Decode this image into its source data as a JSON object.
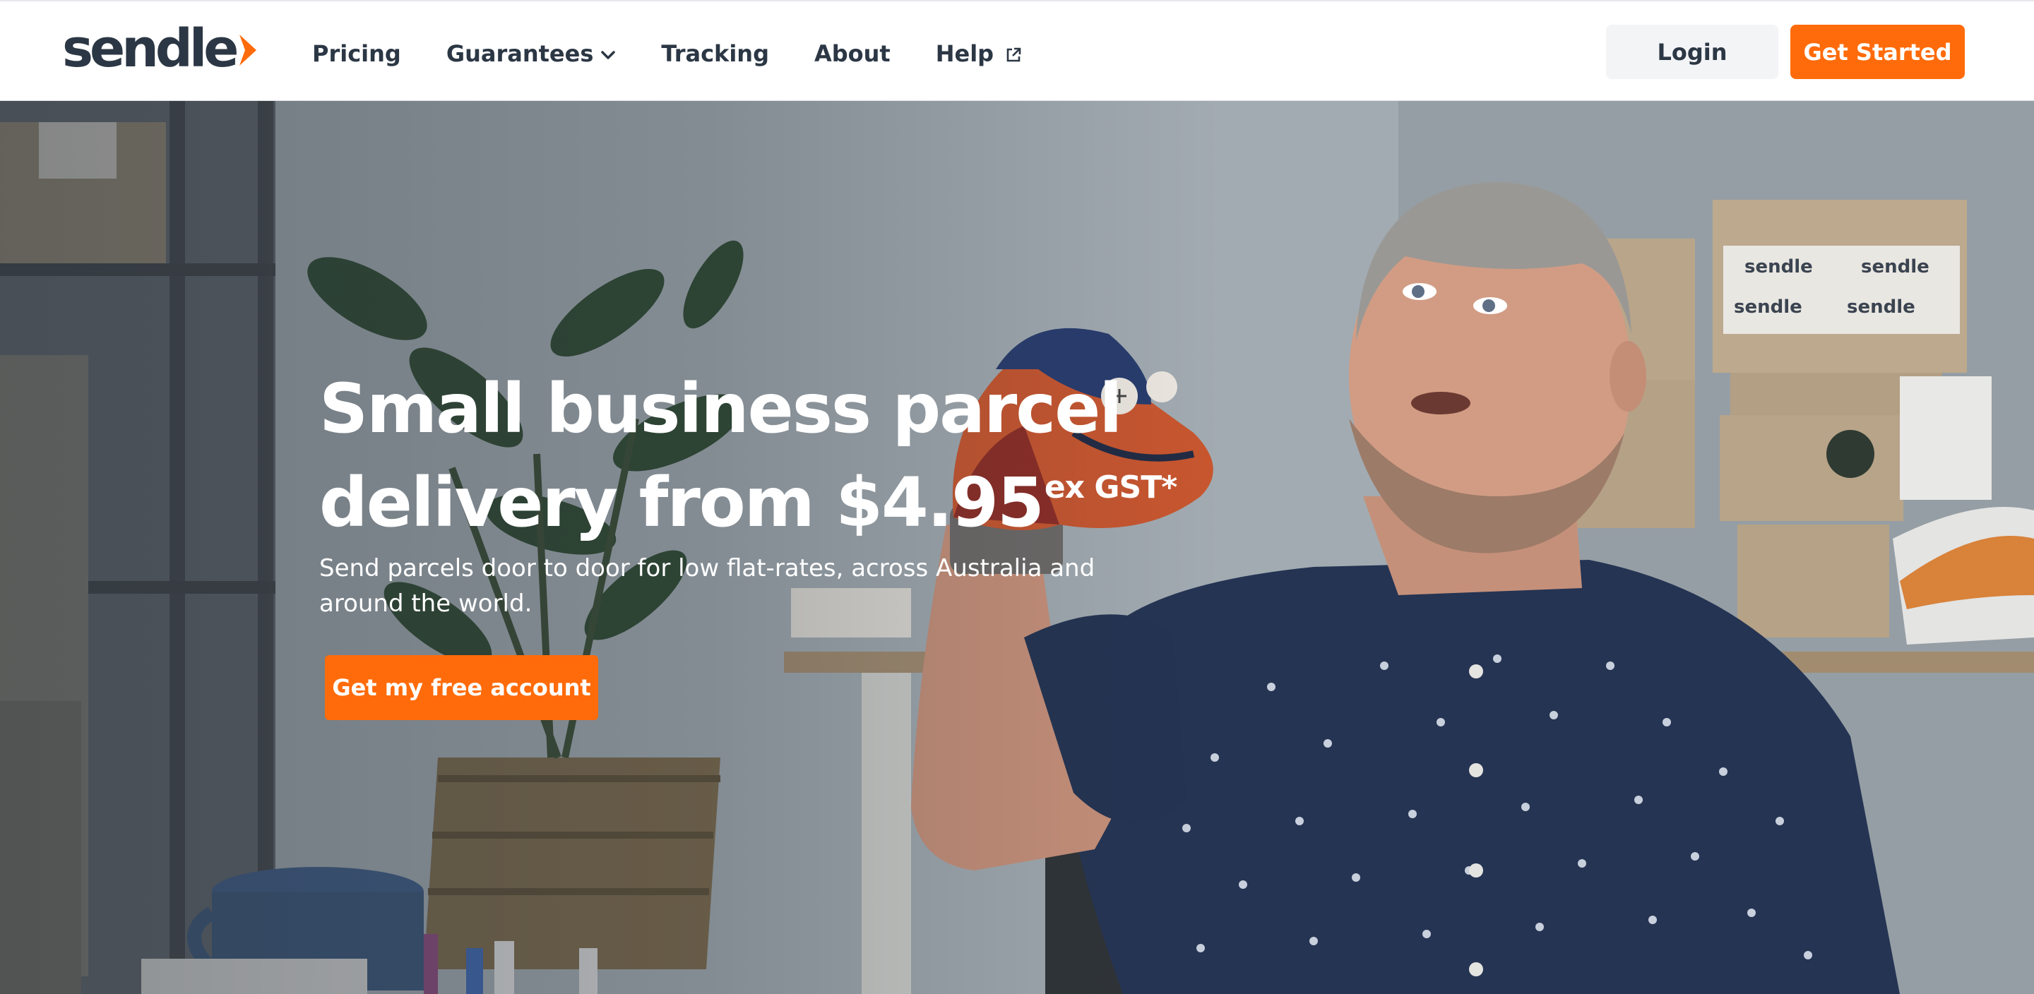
{
  "brand": {
    "name": "sendle",
    "primary_color": "#ff6b0a",
    "text_color": "#2c3745"
  },
  "nav": {
    "items": [
      {
        "label": "Pricing",
        "icon": null
      },
      {
        "label": "Guarantees",
        "icon": "chevron-down-icon"
      },
      {
        "label": "Tracking",
        "icon": null
      },
      {
        "label": "About",
        "icon": null
      },
      {
        "label": "Help",
        "icon": "external-link-icon"
      }
    ],
    "login_label": "Login",
    "get_started_label": "Get Started"
  },
  "hero": {
    "headline_line1": "Small business parcel",
    "headline_line2": "delivery from $4.95",
    "headline_suffix": "ex GST*",
    "subheading": "Send parcels door to door for low flat-rates, across Australia and around the world.",
    "cta_label": "Get my free account",
    "box_label": "sendle"
  }
}
